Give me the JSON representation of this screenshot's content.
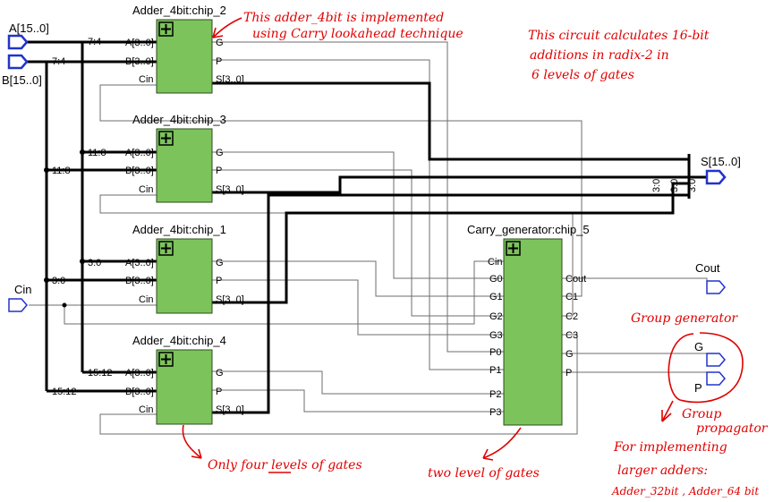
{
  "chips": [
    {
      "title": "Adder_4bit:chip_2",
      "inputs": [
        "A[3..0]",
        "B[3..0]",
        "Cin"
      ],
      "outputs": [
        "G",
        "P",
        "S[3..0]"
      ]
    },
    {
      "title": "Adder_4bit:chip_3",
      "inputs": [
        "A[3..0]",
        "B[3..0]",
        "Cin"
      ],
      "outputs": [
        "G",
        "P",
        "S[3..0]"
      ]
    },
    {
      "title": "Adder_4bit:chip_1",
      "inputs": [
        "A[3..0]",
        "B[3..0]",
        "Cin"
      ],
      "outputs": [
        "G",
        "P",
        "S[3..0]"
      ]
    },
    {
      "title": "Adder_4bit:chip_4",
      "inputs": [
        "A[3..0]",
        "B[3..0]",
        "Cin"
      ],
      "outputs": [
        "G",
        "P",
        "S[3..0]"
      ]
    }
  ],
  "carry_generator": {
    "title": "Carry_generator:chip_5",
    "inputs": [
      "Cin",
      "G0",
      "G1",
      "G2",
      "G3",
      "P0",
      "P1",
      "P2",
      "P3"
    ],
    "outputs": [
      "Cout",
      "C1",
      "C2",
      "C3",
      "G",
      "P"
    ]
  },
  "ports": {
    "a": "A[15..0]",
    "b": "B[15..0]",
    "cin": "Cin",
    "s": "S[15..0]",
    "cout": "Cout",
    "g": "G",
    "p": "P"
  },
  "bus_labels": {
    "a_7_4": "7:4",
    "b_7_4": "7:4",
    "a_11_8": "11:8",
    "b_11_8": "11:8",
    "a_3_0": "3:0",
    "b_3_0": "3:0",
    "a_15_12": "15:12",
    "b_15_12": "15:12",
    "s_a": "3:0",
    "s_b": "3:0",
    "s_c": "3:0"
  },
  "notes": {
    "adder_line1": "This adder_4bit is implemented",
    "adder_line2": "using Carry lookahead technique",
    "circuit_line1": "This circuit calculates 16-bit",
    "circuit_line2": "additions in radix-2 in",
    "circuit_line3": "6 levels of gates",
    "group_generator": "Group generator",
    "group_propagator_1": "Group",
    "group_propagator_2": "propagator",
    "larger_1": "For implementing",
    "larger_2": "larger adders:",
    "larger_3": "Adder_32bit , Adder_64 bit",
    "four_levels": "Only four levels of gates",
    "two_levels": "two level of gates"
  }
}
